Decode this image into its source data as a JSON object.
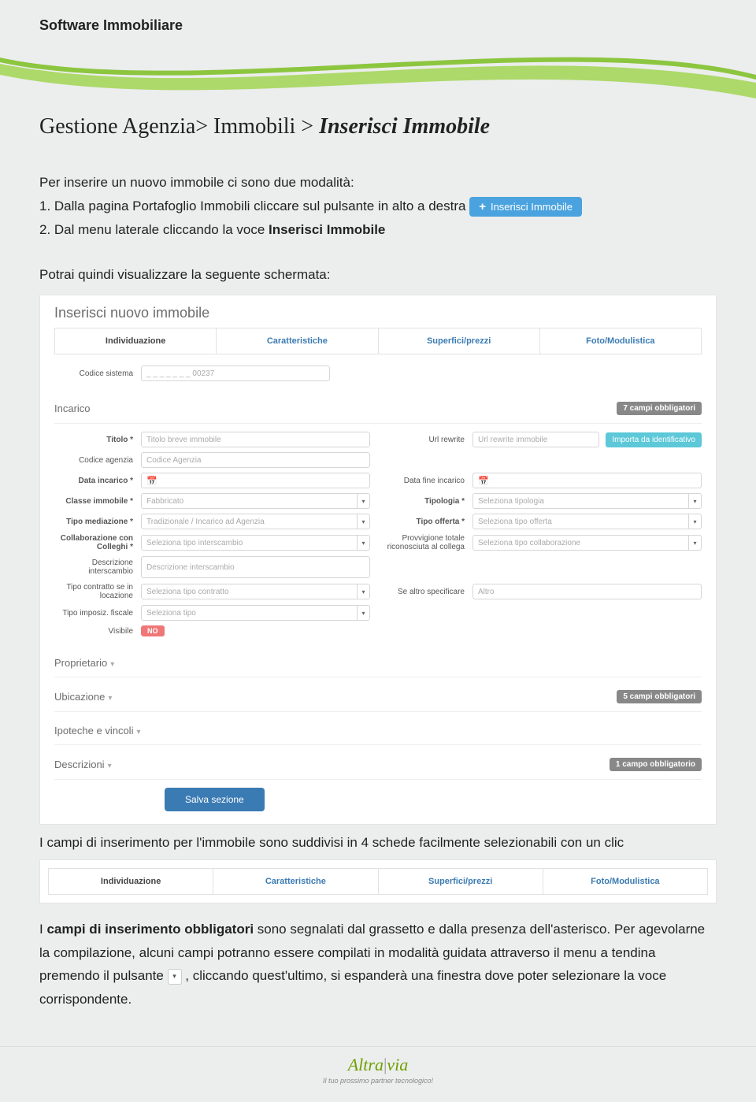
{
  "header_title": "Software Immobiliare",
  "breadcrumb": {
    "part1": "Gestione Agenzia> Immobili > ",
    "emph": "Inserisci Immobile"
  },
  "intro": "Per inserire un nuovo immobile ci sono due modalità:",
  "step1_pre": "1.   Dalla pagina Portafoglio Immobili cliccare sul pulsante in alto a destra  ",
  "insert_button_label": "Inserisci Immobile",
  "step2_pre": "2.   Dal menu laterale cliccando la voce ",
  "step2_bold": "Inserisci Immobile",
  "para_lead": "Potrai quindi visualizzare la seguente schermata:",
  "screenshot": {
    "panel_title": "Inserisci nuovo immobile",
    "tabs": [
      "Individuazione",
      "Caratteristiche",
      "Superfici/prezzi",
      "Foto/Modulistica"
    ],
    "codice_sistema_label": "Codice sistema",
    "codice_sistema_value": "_ _ _ _ _ _ _ 00237",
    "incarico": {
      "title": "Incarico",
      "badge": "7 campi obbligatori",
      "fields": {
        "titolo_label": "Titolo *",
        "titolo_ph": "Titolo breve immobile",
        "url_label": "Url rewrite",
        "url_ph": "Url rewrite immobile",
        "import_btn": "Importa da identificativo",
        "codice_agenzia_label": "Codice agenzia",
        "codice_agenzia_ph": "Codice Agenzia",
        "data_incarico_label": "Data incarico *",
        "data_fine_label": "Data fine incarico",
        "classe_label": "Classe immobile *",
        "classe_val": "Fabbricato",
        "tipologia_label": "Tipologia *",
        "tipologia_ph": "Seleziona tipologia",
        "tipo_med_label": "Tipo mediazione *",
        "tipo_med_val": "Tradizionale / Incarico ad Agenzia",
        "tipo_off_label": "Tipo offerta *",
        "tipo_off_ph": "Seleziona tipo offerta",
        "collab_label": "Collaborazione con Colleghi *",
        "collab_ph": "Seleziona tipo interscambio",
        "provv_label": "Provvigione totale riconosciuta al collega",
        "provv_ph": "Seleziona tipo collaborazione",
        "desc_int_label": "Descrizione interscambio",
        "desc_int_ph": "Descrizione interscambio",
        "tipo_contr_label": "Tipo contratto se in locazione",
        "tipo_contr_ph": "Seleziona tipo contratto",
        "se_altro_label": "Se altro specificare",
        "se_altro_ph": "Altro",
        "tipo_imp_label": "Tipo imposiz. fiscale",
        "tipo_imp_ph": "Seleziona tipo",
        "visibile_label": "Visibile",
        "visibile_val": "NO"
      }
    },
    "sections": {
      "proprietario": "Proprietario",
      "ubicazione": "Ubicazione",
      "ubicazione_badge": "5 campi obbligatori",
      "ipoteche": "Ipoteche e vincoli",
      "descrizioni": "Descrizioni",
      "descrizioni_badge": "1 campo obbligatorio"
    },
    "save_btn": "Salva sezione"
  },
  "after_shot": "I campi di inserimento per l'immobile sono suddivisi in 4 schede facilmente selezionabili con un clic",
  "tabs2": [
    "Individuazione",
    "Caratteristiche",
    "Superfici/prezzi",
    "Foto/Modulistica"
  ],
  "para_final": {
    "p1a": "I ",
    "p1b": "campi di inserimento obbligatori",
    "p1c": " sono segnalati dal grassetto e dalla presenza dell'asterisco. Per agevolarne la compilazione, alcuni campi potranno essere compilati in modalità guidata attraverso il menu a tendina premendo il pulsante ",
    "p1d": ", cliccando quest'ultimo, si espanderà una finestra dove poter selezionare la voce corrispondente."
  },
  "footer": {
    "brand_a": "Altra",
    "brand_b": "via",
    "tagline": "Il tuo prossimo partner tecnologico!"
  }
}
